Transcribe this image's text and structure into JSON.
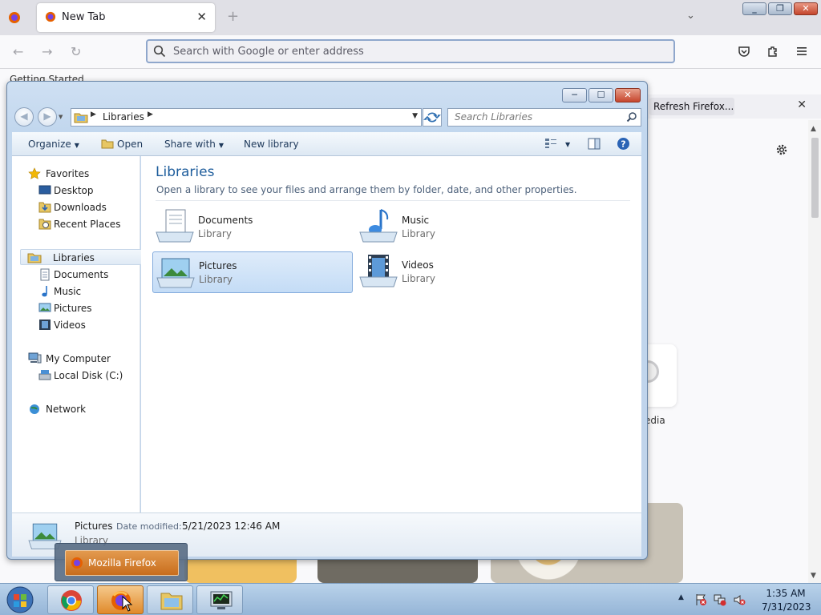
{
  "firefox": {
    "tab": {
      "title": "New Tab",
      "close": "✕"
    },
    "new_tab": "+",
    "tab_list": "⌄",
    "window_buttons": {
      "minimize": "_",
      "restore": "❐",
      "close": "✕"
    },
    "nav": {
      "back": "←",
      "forward": "→",
      "reload": "↻"
    },
    "urlbar": {
      "placeholder": "Search with Google or enter address"
    },
    "bookmark": "Getting Started",
    "notice": {
      "button": "Refresh Firefox...",
      "close": "✕"
    },
    "shortcut_label": "edia"
  },
  "explorer": {
    "window_buttons": {
      "minimize": "─",
      "maximize": "☐",
      "close": "✕"
    },
    "address": {
      "crumb": "Libraries"
    },
    "search": {
      "placeholder": "Search Libraries"
    },
    "commands": {
      "organize": "Organize",
      "open": "Open",
      "share_with": "Share with",
      "new_library": "New library"
    },
    "nav_tree": {
      "favorites": "Favorites",
      "desktop": "Desktop",
      "downloads": "Downloads",
      "recent_places": "Recent Places",
      "libraries": "Libraries",
      "documents": "Documents",
      "music": "Music",
      "pictures": "Pictures",
      "videos": "Videos",
      "my_computer": "My Computer",
      "local_disk": "Local Disk (C:)",
      "network": "Network"
    },
    "content": {
      "title": "Libraries",
      "subtitle": "Open a library to see your files and arrange them by folder, date, and other properties.",
      "libraries": [
        {
          "name": "Documents",
          "type": "Library"
        },
        {
          "name": "Music",
          "type": "Library"
        },
        {
          "name": "Pictures",
          "type": "Library"
        },
        {
          "name": "Videos",
          "type": "Library"
        }
      ]
    },
    "details": {
      "name": "Pictures",
      "date_label": "Date modified:",
      "date_value": "5/21/2023 12:46 AM",
      "type": "Library"
    }
  },
  "taskbar": {
    "preview_label": "Mozilla Firefox",
    "clock": {
      "time": "1:35 AM",
      "date": "7/31/2023"
    }
  }
}
